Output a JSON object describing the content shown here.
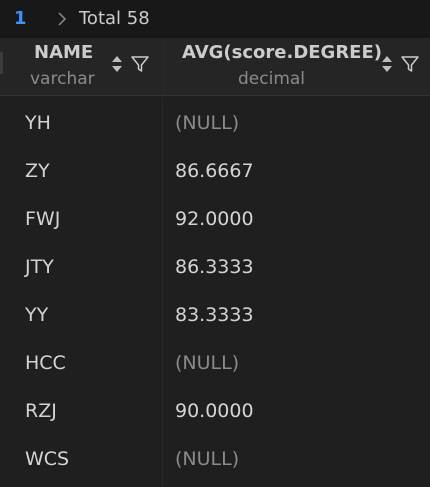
{
  "pager": {
    "page": "1",
    "total_label": "Total 58"
  },
  "columns": [
    {
      "name": "NAME",
      "type": "varchar"
    },
    {
      "name": "AVG(score.DEGREE)",
      "type": "decimal"
    }
  ],
  "rows": [
    {
      "name": "YH",
      "avg": "(NULL)"
    },
    {
      "name": "ZY",
      "avg": "86.6667"
    },
    {
      "name": "FWJ",
      "avg": "92.0000"
    },
    {
      "name": "JTY",
      "avg": "86.3333"
    },
    {
      "name": "YY",
      "avg": "83.3333"
    },
    {
      "name": "HCC",
      "avg": "(NULL)"
    },
    {
      "name": "RZJ",
      "avg": "90.0000"
    },
    {
      "name": "WCS",
      "avg": "(NULL)"
    }
  ],
  "colors": {
    "accent": "#3794ff",
    "null_text": "#8b8b8b"
  }
}
